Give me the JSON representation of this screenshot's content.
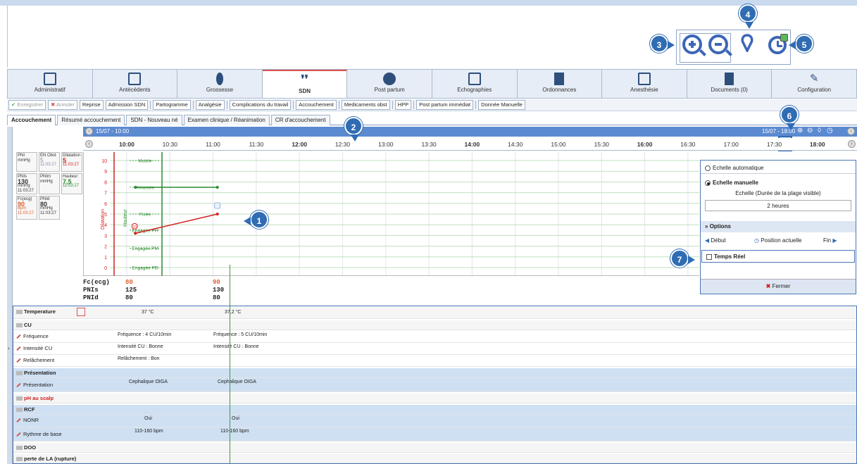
{
  "callouts": [
    "1",
    "2",
    "3",
    "4",
    "5",
    "6",
    "7"
  ],
  "main_tabs": [
    {
      "label": "Administratif",
      "icon": "clipboard-icon"
    },
    {
      "label": "Antécédents",
      "icon": "history-icon"
    },
    {
      "label": "Grossesse",
      "icon": "pregnancy-icon"
    },
    {
      "label": "SDN",
      "icon": "footprints-icon"
    },
    {
      "label": "Post partum",
      "icon": "mother-baby-icon"
    },
    {
      "label": "Echographies",
      "icon": "ultrasound-icon"
    },
    {
      "label": "Ordonnances",
      "icon": "prescription-icon"
    },
    {
      "label": "Anesthésie",
      "icon": "anesthesia-icon"
    },
    {
      "label": "Documents (0)",
      "icon": "documents-icon"
    },
    {
      "label": "Configuration",
      "icon": "wrench-icon"
    }
  ],
  "active_tab": "SDN",
  "toolbar": {
    "save": "Enregistrer",
    "cancel": "Annuler",
    "reprise": "Reprise",
    "admission": "Admission SDN",
    "partogramme": "Partogramme",
    "analgesie": "Analgésie",
    "complications": "Complications du travail",
    "accouchement": "Accouchement",
    "medicaments": "Medicaments obst",
    "hpp": "HPP",
    "post_partum": "Post partum immédiat",
    "donnee": "Donnée Manuelle"
  },
  "sub_tabs": [
    "Accouchement",
    "Résumé accouchement",
    "SDN - Nouveau né",
    "Examen clinique / Réanimation",
    "CR d'accouchement"
  ],
  "timeline": {
    "start": "15/07 - 10:00",
    "end": "15/07 - 18:00",
    "ticks": [
      {
        "label": "10:00",
        "bold": true
      },
      {
        "label": "10:30",
        "bold": false
      },
      {
        "label": "11:00",
        "bold": false
      },
      {
        "label": "11:30",
        "bold": false
      },
      {
        "label": "12:00",
        "bold": true
      },
      {
        "label": "12:30",
        "bold": false
      },
      {
        "label": "13:00",
        "bold": false
      },
      {
        "label": "13:30",
        "bold": false
      },
      {
        "label": "14:00",
        "bold": true
      },
      {
        "label": "14:30",
        "bold": false
      },
      {
        "label": "15:00",
        "bold": false
      },
      {
        "label": "15:30",
        "bold": false
      },
      {
        "label": "16:00",
        "bold": true
      },
      {
        "label": "16:30",
        "bold": false
      },
      {
        "label": "17:00",
        "bold": false
      },
      {
        "label": "17:30",
        "bold": false
      },
      {
        "label": "18:00",
        "bold": true
      }
    ]
  },
  "vitals_boxes": {
    "pni": {
      "title": "PNI",
      "unit": "mmHg"
    },
    "en_obst": {
      "title": "EN Obst",
      "value": "5",
      "time": "11:03:27"
    },
    "dilatation": {
      "title": "Dilatation",
      "value": "5",
      "time": "11:03:27"
    },
    "pnis": {
      "title": "PNIs",
      "value": "130",
      "unit": "mmHg",
      "time": "11:03:27"
    },
    "pnim": {
      "title": "PNIm",
      "unit": "mmHg"
    },
    "hauteur": {
      "title": "Hauteur",
      "value": "7,5",
      "time": "11:03:27"
    },
    "fc": {
      "title": "Fc(ecg)",
      "value": "90",
      "unit": "Bpm",
      "time": "11:03:27"
    },
    "pnid": {
      "title": "PNId",
      "value": "80",
      "unit": "mmHg",
      "time": "11:03:27"
    }
  },
  "partogram": {
    "y_axis_label": "Dilatation",
    "hauteur_label": "Hauteur",
    "y_ticks": [
      "10",
      "9",
      "8",
      "7",
      "6",
      "5",
      "4",
      "3",
      "2",
      "1",
      "0"
    ],
    "stations": [
      "Mobile",
      "Amorcée",
      "Fixée",
      "Engagée PH",
      "Engagée PM",
      "Engagée PB"
    ],
    "dilatation_points": [
      {
        "time": "10:06",
        "value": 3.2
      },
      {
        "time": "11:03",
        "value": 5
      }
    ],
    "hauteur_points": [
      {
        "time": "10:06",
        "value": 7.5
      },
      {
        "time": "11:03",
        "value": 7.5
      }
    ],
    "line_colors": {
      "dilatation": "#d42020",
      "hauteur": "#2a8a2a"
    },
    "marker_label": "10"
  },
  "vitals_rows": [
    {
      "label": "Fc(ecg)",
      "v1": "80",
      "v2": "90",
      "color": "#e06030"
    },
    {
      "label": "PNIs",
      "v1": "125",
      "v2": "130",
      "color": "#111"
    },
    {
      "label": "PNId",
      "v1": "80",
      "v2": "80",
      "color": "#111"
    }
  ],
  "panel": {
    "auto": "Echelle automatique",
    "manual": "Echelle manuelle",
    "scale_label": "Echelle (Durée de la plage visible)",
    "scale_value": "2 heures",
    "options": "Options",
    "debut": "Début",
    "position": "Position actuelle",
    "fin": "Fin",
    "realtime": "Temps Réel",
    "close": "Fermer"
  },
  "grid_rows": {
    "temperature": {
      "label": "Temperature",
      "v1": "37 °C",
      "v2": "37,2 °C"
    },
    "cu": {
      "label": "CU"
    },
    "frequence": {
      "label": "Fréquence",
      "v1": "Fréquence : 4 CU/10min",
      "v2": "Fréquence : 5 CU/10min"
    },
    "intensite": {
      "label": "Intensité CU",
      "v1": "Intensité CU : Bonne",
      "v2": "Intensité CU : Bonne"
    },
    "relachement": {
      "label": "Relâchement",
      "v1": "Relâchement : Bon"
    },
    "presentation_h": {
      "label": "Présentation"
    },
    "presentation": {
      "label": "Présentation",
      "v1": "Cephalique OIGA",
      "v2": "Cephalique OIGA"
    },
    "ph": {
      "label": "pH au scalp"
    },
    "rcf": {
      "label": "RCF"
    },
    "nonr": {
      "label": "NONR",
      "v1": "Oui",
      "v2": "Oui"
    },
    "rythme": {
      "label": "Rythme de base",
      "v1": "110-160 bpm",
      "v2": "110-160 bpm"
    },
    "doo": {
      "label": "DOO"
    },
    "perte": {
      "label": "perte de LA (rupture)"
    }
  }
}
